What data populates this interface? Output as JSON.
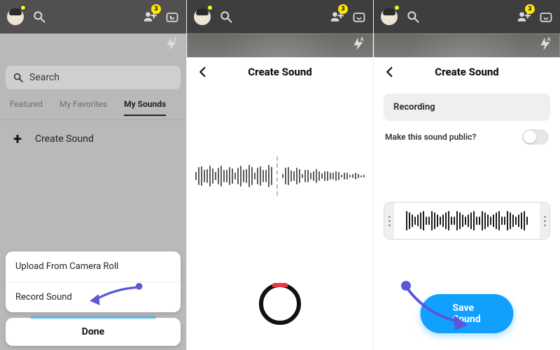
{
  "badge_count": "3",
  "panel1": {
    "search_placeholder": "Search",
    "tabs": {
      "featured": "Featured",
      "favorites": "My Favorites",
      "sounds": "My Sounds"
    },
    "create_label": "Create Sound",
    "sheet": {
      "upload": "Upload From Camera Roll",
      "record": "Record Sound",
      "done": "Done"
    }
  },
  "panel2": {
    "title": "Create Sound"
  },
  "panel3": {
    "title": "Create Sound",
    "recording_label": "Recording",
    "public_label": "Make this sound public?",
    "save_label": "Save Sound"
  }
}
